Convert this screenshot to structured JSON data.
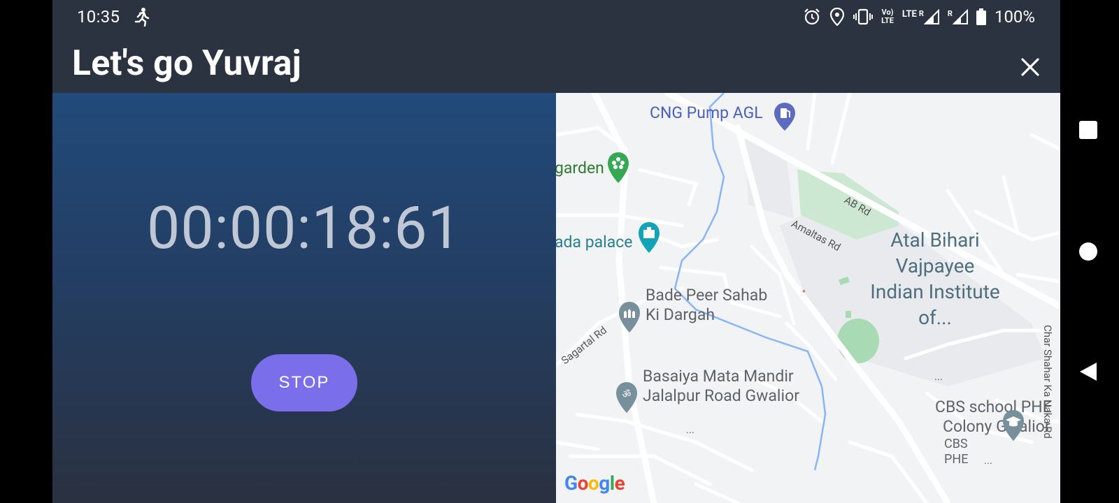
{
  "status_bar": {
    "time": "10:35",
    "battery": "100%",
    "network_top": "Vo)",
    "network_bottom": "LTE",
    "lte": "LTE",
    "roam": "R"
  },
  "app_bar": {
    "title": "Let's go Yuvraj"
  },
  "timer": {
    "display": "00:00:18:61",
    "stop_label": "STOP"
  },
  "map": {
    "labels": {
      "cng_pump": "CNG Pump AGL",
      "garden": "garden",
      "palace": "ada palace",
      "dargah_1": "Bade Peer Sahab",
      "dargah_2": "Ki Dargah",
      "mandir_1": "Basaiya Mata Mandir",
      "mandir_2": "Jalalpur Road Gwalior",
      "institute_1": "Atal Bihari",
      "institute_2": "Vajpayee",
      "institute_3": "Indian Institute",
      "institute_4": "of...",
      "school_1": "CBS school PHE",
      "school_2": "Colony Gwalior",
      "cbs_1": "CBS",
      "cbs_2": "PHE",
      "ellipsis": "..."
    },
    "roads": {
      "ab_rd": "AB Rd",
      "amaltas_rd": "Amaltas Rd",
      "sagartal_rd": "Sagartal Rd",
      "char_shahar": "Char Shahar Ka Naka Rd"
    },
    "attribution": "Google"
  },
  "colors": {
    "accent": "#7a6eea",
    "header_bg": "#2b3340",
    "timer_text": "#bfc7d4"
  }
}
